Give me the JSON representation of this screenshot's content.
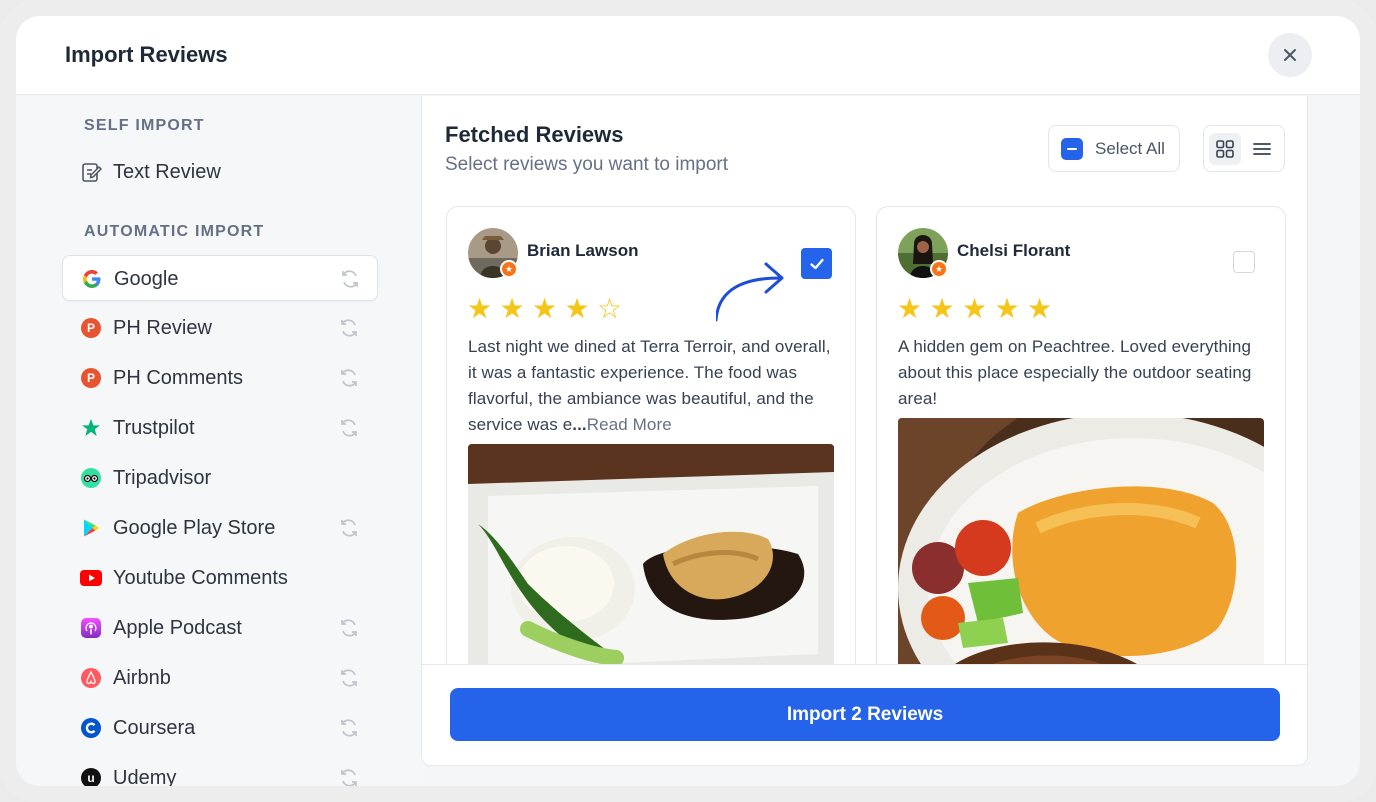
{
  "modal": {
    "title": "Import Reviews"
  },
  "sidebar": {
    "self_import_label": "SELF IMPORT",
    "text_review_label": "Text Review",
    "automatic_import_label": "AUTOMATIC IMPORT",
    "items": [
      {
        "label": "Google",
        "icon": "google-icon",
        "sync": true,
        "active": true
      },
      {
        "label": "PH Review",
        "icon": "producthunt-icon",
        "sync": true
      },
      {
        "label": "PH Comments",
        "icon": "producthunt-icon",
        "sync": true
      },
      {
        "label": "Trustpilot",
        "icon": "trustpilot-star-icon",
        "sync": true
      },
      {
        "label": "Tripadvisor",
        "icon": "tripadvisor-icon",
        "sync": false
      },
      {
        "label": "Google Play Store",
        "icon": "google-play-icon",
        "sync": true
      },
      {
        "label": "Youtube Comments",
        "icon": "youtube-icon",
        "sync": false
      },
      {
        "label": "Apple Podcast",
        "icon": "apple-podcast-icon",
        "sync": true
      },
      {
        "label": "Airbnb",
        "icon": "airbnb-icon",
        "sync": true
      },
      {
        "label": "Coursera",
        "icon": "coursera-icon",
        "sync": true
      },
      {
        "label": "Udemy",
        "icon": "udemy-icon",
        "sync": true
      }
    ]
  },
  "main": {
    "title": "Fetched Reviews",
    "subtitle": "Select reviews you want to import",
    "select_all_label": "Select All",
    "view_modes": [
      "grid",
      "list"
    ],
    "active_view": "grid"
  },
  "reviews": [
    {
      "name": "Brian Lawson",
      "rating": 4,
      "selected": true,
      "text": "Last night we dined at Terra Terroir, and overall, it was a fantastic experience. The food was flavorful, the ambiance was beautiful, and the service was e",
      "ellipsis": "...",
      "read_more": "Read More"
    },
    {
      "name": "Chelsi Florant",
      "rating": 5,
      "selected": false,
      "text": "A hidden gem on Peachtree. Loved everything about this place especially the outdoor seating area!"
    }
  ],
  "footer": {
    "import_label": "Import 2 Reviews"
  },
  "colors": {
    "accent": "#2563eb",
    "star": "#f5c518",
    "badge": "#f97316"
  }
}
